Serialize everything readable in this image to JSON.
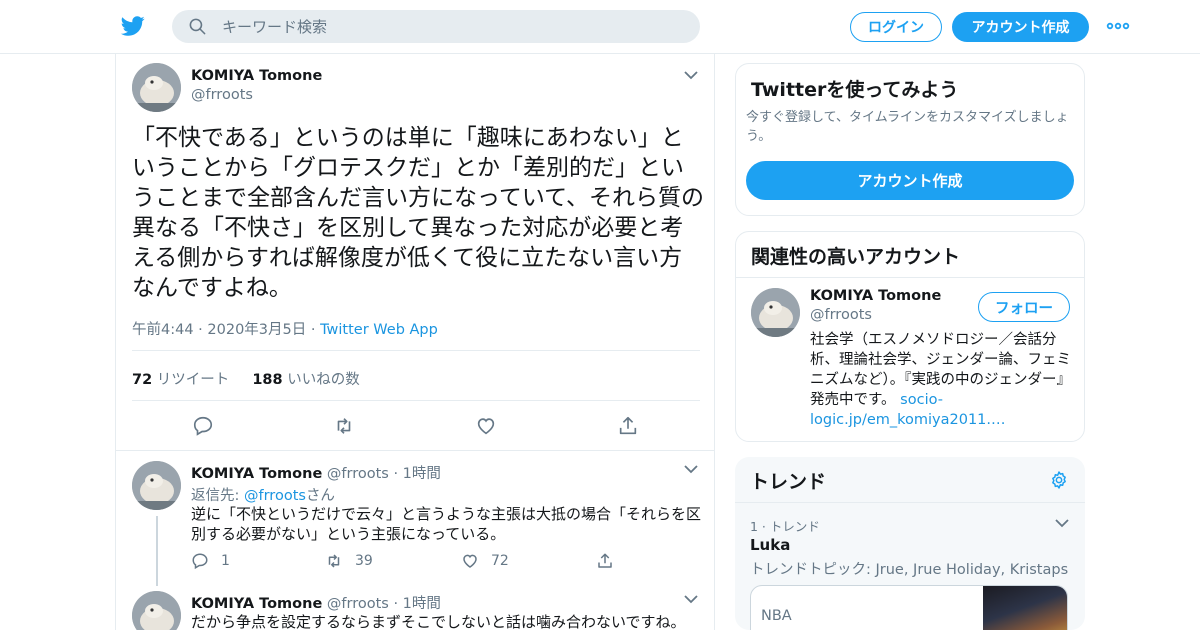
{
  "header": {
    "search_placeholder": "キーワード検索",
    "login_label": "ログイン",
    "signup_label": "アカウント作成",
    "brand_color": "#1da1f2"
  },
  "tweet": {
    "author_name": "KOMIYA Tomone",
    "author_handle": "@frroots",
    "text": "「不快である」というのは単に「趣味にあわない」ということから「グロテスクだ」とか「差別的だ」ということまで全部含んだ言い方になっていて、それら質の異なる「不快さ」を区別して異なった対応が必要と考える側からすれば解像度が低くて役に立たない言い方なんですよね。",
    "time": "午前4:44 · 2020年3月5日 · ",
    "app": "Twitter Web App",
    "retweet_count": "72",
    "retweet_label": "リツイート",
    "like_count": "188",
    "like_label": "いいねの数"
  },
  "replies": [
    {
      "author_name": "KOMIYA Tomone",
      "author_handle": "@frroots",
      "time": "· 1時間",
      "reply_to_label": "返信先: ",
      "reply_to_mention": "@frroots",
      "reply_to_suffix": "さん",
      "text": "逆に「不快というだけで云々」と言うような主張は大抵の場合「それらを区別する必要がない」という主張になっている。",
      "reply_count": "1",
      "retweet_count": "39",
      "like_count": "72"
    },
    {
      "author_name": "KOMIYA Tomone",
      "author_handle": "@frroots",
      "time": "· 1時間",
      "text": "だから争点を設定するならまずそこでしないと話は噛み合わないですね。"
    }
  ],
  "sidebar": {
    "signup_card": {
      "title": "Twitterを使ってみよう",
      "subtitle": "今すぐ登録して、タイムラインをカスタマイズしましょう。",
      "button": "アカウント作成"
    },
    "related_card": {
      "title": "関連性の高いアカウント",
      "name": "KOMIYA Tomone",
      "handle": "@frroots",
      "follow_label": "フォロー",
      "bio": "社会学（エスノメソドロジー／会話分析、理論社会学、ジェンダー論、フェミニズムなど）。『実践の中のジェンダー』発売中です。 ",
      "bio_link": "socio-logic.jp/em_komiya2011.…"
    },
    "trends_card": {
      "title": "トレンド",
      "trend_rank": "1 · トレンド",
      "trend_name": "Luka",
      "trend_desc": "トレンドトピック: Jrue, Jrue Holiday, Kristaps",
      "media_label": "NBA"
    }
  }
}
